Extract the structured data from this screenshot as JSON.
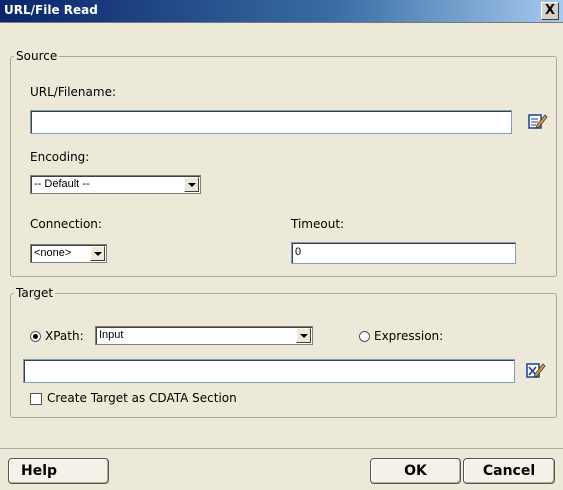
{
  "window": {
    "title": "URL/File Read",
    "close_label": "X"
  },
  "source": {
    "legend": "Source",
    "url_label": "URL/Filename:",
    "url_value": "",
    "encoding_label": "Encoding:",
    "encoding_value": "-- Default --",
    "connection_label": "Connection:",
    "connection_value": "<none>",
    "timeout_label": "Timeout:",
    "timeout_value": "0",
    "edit_icon": "edit-pencil-icon"
  },
  "target": {
    "legend": "Target",
    "xpath_label": "XPath:",
    "xpath_selected": true,
    "xpath_value": "Input",
    "expression_label": "Expression:",
    "expression_selected": false,
    "expression_value": "",
    "cdata_label": "Create Target as CDATA Section",
    "cdata_checked": false,
    "expression_icon": "expression-editor-icon"
  },
  "buttons": {
    "help": "Help",
    "ok": "OK",
    "cancel": "Cancel"
  }
}
